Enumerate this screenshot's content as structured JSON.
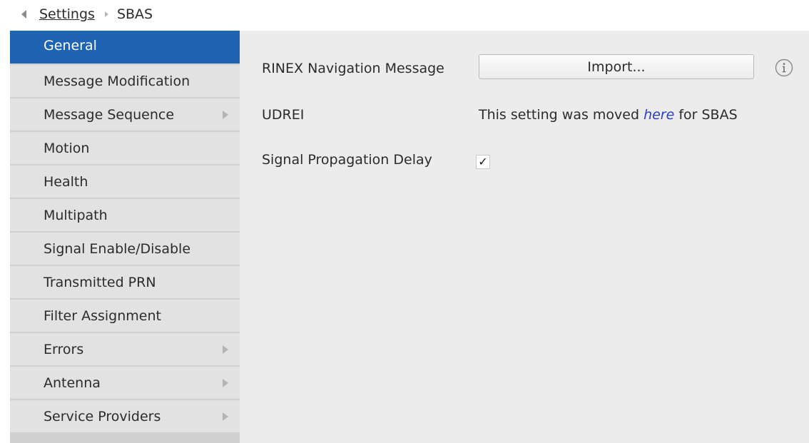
{
  "breadcrumb": {
    "parent": "Settings",
    "current": "SBAS"
  },
  "sidebar": {
    "items": [
      {
        "label": "General",
        "active": true,
        "has_submenu": false
      },
      {
        "label": "Message Modification",
        "active": false,
        "has_submenu": false
      },
      {
        "label": "Message Sequence",
        "active": false,
        "has_submenu": true
      },
      {
        "label": "Motion",
        "active": false,
        "has_submenu": false
      },
      {
        "label": "Health",
        "active": false,
        "has_submenu": false
      },
      {
        "label": "Multipath",
        "active": false,
        "has_submenu": false
      },
      {
        "label": "Signal Enable/Disable",
        "active": false,
        "has_submenu": false
      },
      {
        "label": "Transmitted PRN",
        "active": false,
        "has_submenu": false
      },
      {
        "label": "Filter Assignment",
        "active": false,
        "has_submenu": false
      },
      {
        "label": "Errors",
        "active": false,
        "has_submenu": true
      },
      {
        "label": "Antenna",
        "active": false,
        "has_submenu": true
      },
      {
        "label": "Service Providers",
        "active": false,
        "has_submenu": true
      }
    ]
  },
  "main": {
    "rinex": {
      "label": "RINEX Navigation Message",
      "button_label": "Import...",
      "info_icon": "info-icon"
    },
    "udrei": {
      "label": "UDREI",
      "text_before": "This setting was moved ",
      "link_text": "here",
      "text_after": " for SBAS"
    },
    "signal_delay": {
      "label": "Signal Propagation Delay",
      "checked": true,
      "check_glyph": "✓"
    }
  },
  "colors": {
    "active_item": "#1f64b2",
    "link": "#2a3cc8",
    "panel_bg": "#ececec",
    "sidebar_item_bg": "#e2e2e2"
  }
}
